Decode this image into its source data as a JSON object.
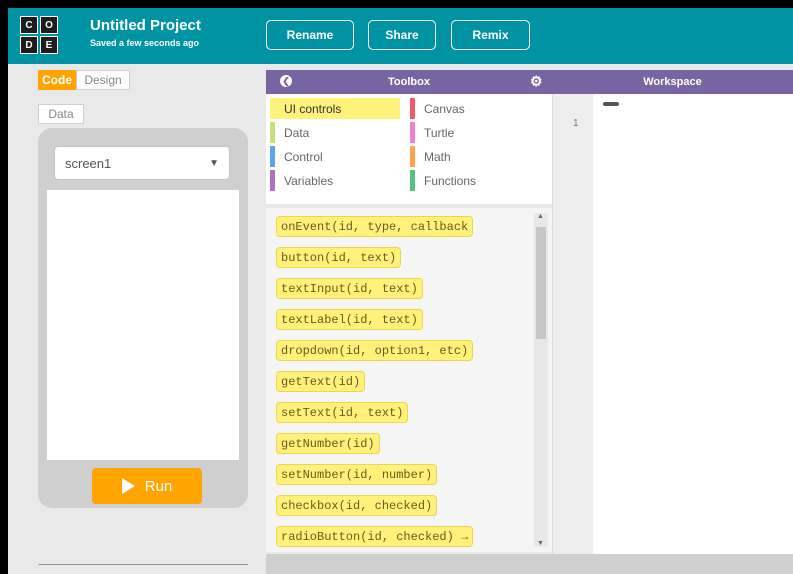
{
  "header": {
    "logo_letters": [
      "C",
      "O",
      "D",
      "E"
    ],
    "title": "Untitled Project",
    "subtitle": "Saved a few seconds ago",
    "buttons": {
      "rename": "Rename",
      "share": "Share",
      "remix": "Remix"
    }
  },
  "left_panel": {
    "tabs": {
      "code": "Code",
      "design": "Design",
      "data": "Data"
    },
    "screen_select": "screen1",
    "run_label": "Run"
  },
  "toolbox": {
    "title": "Toolbox",
    "categories": [
      {
        "label": "UI controls",
        "color": "#fff27a",
        "selected": true
      },
      {
        "label": "Canvas",
        "color": "#f25a6c"
      },
      {
        "label": "Data",
        "color": "#c6e07a"
      },
      {
        "label": "Turtle",
        "color": "#f07fd1"
      },
      {
        "label": "Control",
        "color": "#5aa6f2"
      },
      {
        "label": "Math",
        "color": "#ffa24a"
      },
      {
        "label": "Variables",
        "color": "#b06fc7"
      },
      {
        "label": "Functions",
        "color": "#57c18a"
      }
    ],
    "blocks": [
      "onEvent(id, type, callback",
      "button(id, text)",
      "textInput(id, text)",
      "textLabel(id, text)",
      "dropdown(id, option1, etc)",
      "getText(id)",
      "setText(id, text)",
      "getNumber(id)",
      "setNumber(id, number)",
      "checkbox(id, checked)",
      "radioButton(id, checked) →"
    ]
  },
  "workspace": {
    "title": "Workspace",
    "line_number": "1"
  }
}
